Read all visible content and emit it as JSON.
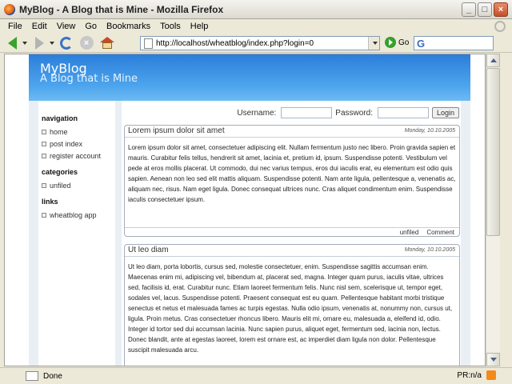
{
  "window": {
    "title": "MyBlog - A Blog that is Mine - Mozilla Firefox",
    "controls": {
      "minimize": "_",
      "maximize": "□",
      "close": "×"
    }
  },
  "menu": [
    "File",
    "Edit",
    "View",
    "Go",
    "Bookmarks",
    "Tools",
    "Help"
  ],
  "toolbar": {
    "url": "http://localhost/wheatblog/index.php?login=0",
    "go_label": "Go",
    "search_glyph": "G"
  },
  "site": {
    "title": "MyBlog",
    "tagline": "A Blog that is Mine"
  },
  "sidebar": {
    "navigation_heading": "navigation",
    "navigation": [
      "home",
      "post index",
      "register account"
    ],
    "categories_heading": "categories",
    "categories": [
      "unfiled"
    ],
    "links_heading": "links",
    "links": [
      "wheatblog app"
    ]
  },
  "login": {
    "username_label": "Username:",
    "password_label": "Password:",
    "button_label": "Login"
  },
  "posts": [
    {
      "title": "Lorem ipsum dolor sit amet",
      "date": "Monday, 10.10.2005",
      "body": "Lorem ipsum dolor sit amet, consectetuer adipiscing elit. Nullam fermentum justo nec libero. Proin gravida sapien et mauris. Curabitur felis tellus, hendrerit sit amet, lacinia et, pretium id, ipsum. Suspendisse potenti. Vestibulum vel pede at eros mollis placerat. Ut commodo, dui nec varius tempus, eros dui iaculis erat, eu elementum est odio quis sapien. Aenean non leo sed elit mattis aliquam. Suspendisse potenti. Nam ante ligula, pellentesque a, venenatis ac, aliquam nec, risus. Nam eget ligula. Donec consequat ultrices nunc. Cras aliquet condimentum enim. Suspendisse iaculis consectetuer ipsum.",
      "category": "unfiled",
      "comment": "Comment"
    },
    {
      "title": "Ut leo diam",
      "date": "Monday, 10.10.2005",
      "body": "Ut leo diam, porta lobortis, cursus sed, molestie consectetuer, enim. Suspendisse sagittis accumsan enim. Maecenas enim mi, adipiscing vel, bibendum at, placerat sed, magna. Integer quam purus, iaculis vitae, ultrices sed, facilisis id, erat. Curabitur nunc. Etiam laoreet fermentum felis. Nunc nisl sem, scelerisque ut, tempor eget, sodales vel, lacus. Suspendisse potenti. Praesent consequat est eu quam. Pellentesque habitant morbi tristique senectus et netus et malesuada fames ac turpis egestas. Nulla odio ipsum, venenatis at, nonummy non, cursus ut, ligula. Proin metus. Cras consectetuer rhoncus libero. Mauris elit mi, ornare eu, malesuada a, eleifend id, odio. Integer id tortor sed dui accumsan lacinia. Nunc sapien purus, aliquet eget, fermentum sed, lacinia non, lectus. Donec blandit, ante at egestas laoreet, lorem est ornare est, ac imperdiet diam ligula non dolor. Pellentesque suscipit malesuada arcu."
    }
  ],
  "status": {
    "text": "Done",
    "right": "PR:n/a"
  },
  "colors": {
    "header_blue": "#2b7ed9",
    "page_background": "#e9eff4"
  }
}
